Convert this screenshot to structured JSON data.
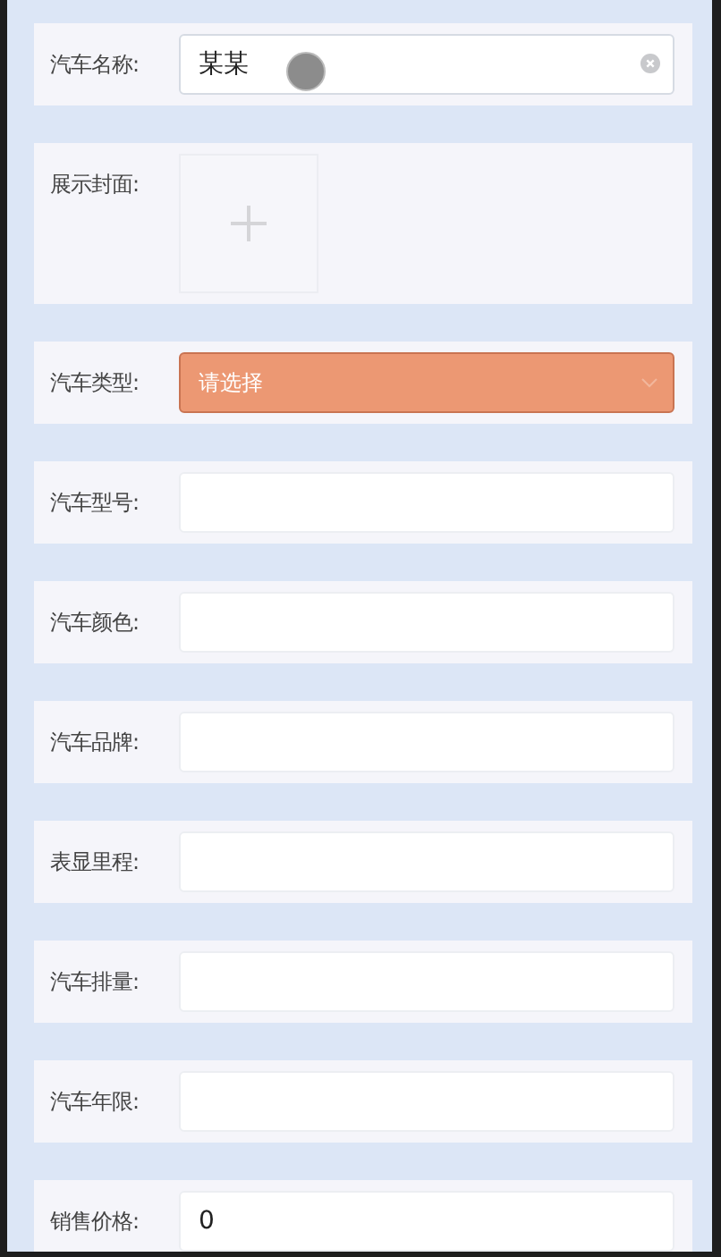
{
  "fields": [
    {
      "kind": "text",
      "label": "汽车名称:",
      "value": "某某",
      "clearable": true,
      "focused": true
    },
    {
      "kind": "upload",
      "label": "展示封面:"
    },
    {
      "kind": "select",
      "label": "汽车类型:",
      "placeholder": "请选择",
      "highlighted": true
    },
    {
      "kind": "text",
      "label": "汽车型号:"
    },
    {
      "kind": "text",
      "label": "汽车颜色:"
    },
    {
      "kind": "text",
      "label": "汽车品牌:"
    },
    {
      "kind": "text",
      "label": "表显里程:"
    },
    {
      "kind": "text",
      "label": "汽车排量:"
    },
    {
      "kind": "text",
      "label": "汽车年限:"
    },
    {
      "kind": "text",
      "label": "销售价格:",
      "value": "0"
    }
  ]
}
